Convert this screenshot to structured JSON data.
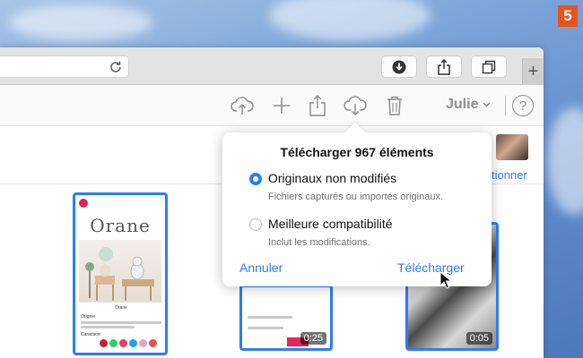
{
  "badge": "5",
  "toolbar": {
    "user_name": "Julie",
    "help_glyph": "?",
    "icons": [
      "upload-icon",
      "plus-icon",
      "share-icon",
      "download-icon",
      "trash-icon"
    ]
  },
  "browser": {
    "buttons": [
      "download-icon",
      "share-icon",
      "tabs-icon"
    ],
    "new_tab_glyph": "+"
  },
  "content": {
    "select_link": "tionner"
  },
  "thumbnails": [
    {
      "title": "Orane",
      "caption_top": "Orane",
      "caption_section1": "Origine",
      "caption_section2": "Caractère",
      "selected": true
    },
    {
      "duration": "0:25",
      "selected": true
    },
    {
      "duration": "0:05",
      "selected": true
    }
  ],
  "popover": {
    "title": "Télécharger 967 éléments",
    "option1_label": "Originaux non modifiés",
    "option1_desc": "Fichiers capturés ou importés originaux.",
    "option1_selected": true,
    "option2_label": "Meilleure compatibilité",
    "option2_desc": "Inclut les modifications.",
    "option2_selected": false,
    "cancel_label": "Annuler",
    "download_label": "Télécharger"
  },
  "colors": {
    "accent": "#2e7cf6",
    "badge": "#e8531e",
    "icon_gray": "#8e8e93"
  }
}
